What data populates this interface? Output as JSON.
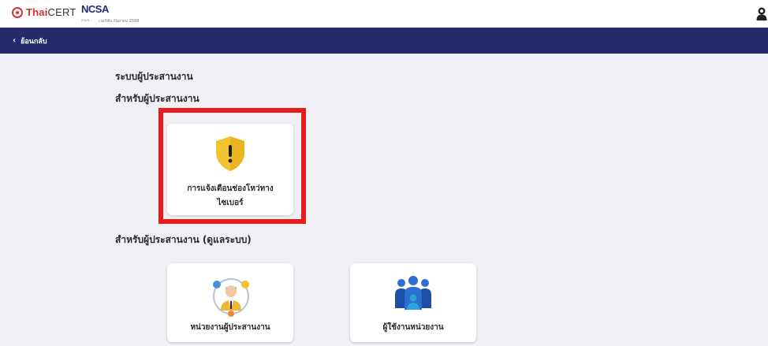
{
  "header": {
    "logo_thaicert_prefix": "Thai",
    "logo_thaicert_suffix": "CERT",
    "logo_ncsa": "NCSA",
    "logo_ncsa_sub": "สกมช.",
    "logo_ncsa_tag": "เวอร์ชัน กันยายน 2568",
    "user_icon": "user-icon"
  },
  "nav": {
    "back_label": "ย้อนกลับ",
    "back_icon": "chevron-left-icon"
  },
  "main": {
    "title": "ระบบผู้ประสานงาน",
    "section1_heading": "สำหรับผู้ประสานงาน",
    "section2_heading": "สำหรับผู้ประสานงาน (ดูแลระบบ)",
    "cards": {
      "alert_label": "การแจ้งเตือนช่องโหว่ทางไซเบอร์",
      "unit_label": "หน่วยงานผู้ประสานงาน",
      "user_label": "ผู้ใช้งานหน่วยงาน"
    }
  },
  "colors": {
    "navbar": "#262a6a",
    "background": "#eef0f6",
    "highlight": "#e61b1b",
    "shield": "#f2c230",
    "brand_red": "#d6322e"
  }
}
